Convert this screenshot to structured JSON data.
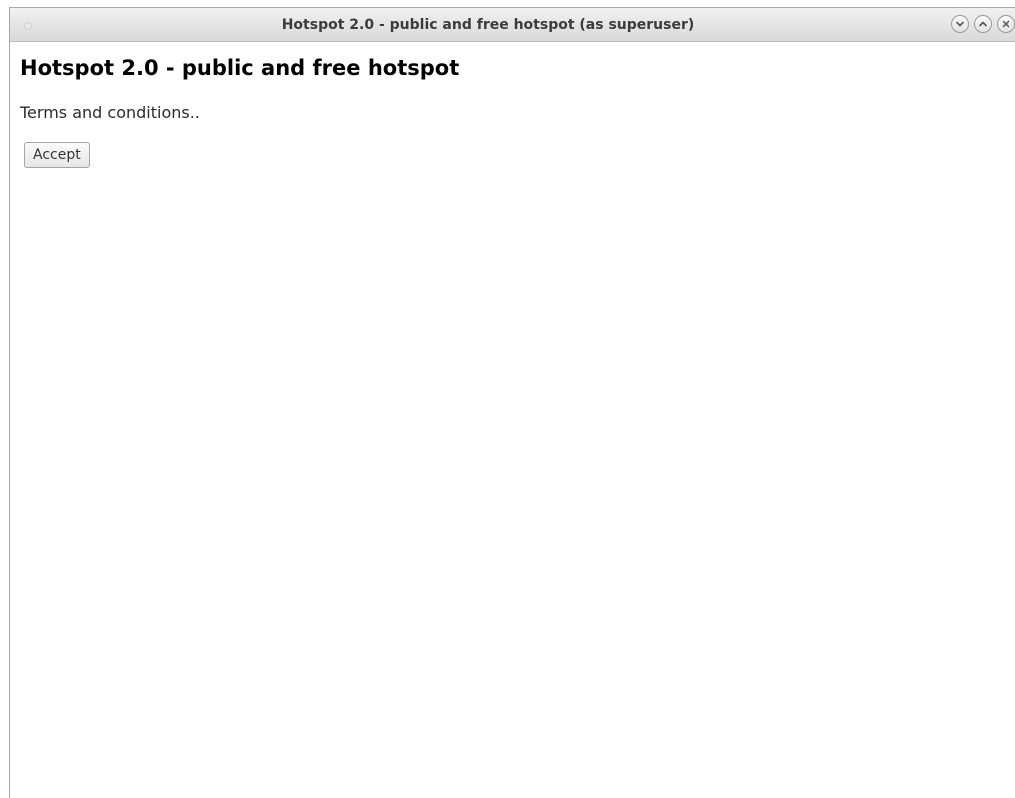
{
  "window": {
    "title": "Hotspot 2.0 - public and free hotspot (as superuser)",
    "controls": [
      "minimize-icon",
      "maximize-icon",
      "close-icon"
    ]
  },
  "page": {
    "heading": "Hotspot 2.0 - public and free hotspot",
    "terms_text": "Terms and conditions..",
    "accept_label": "Accept"
  }
}
